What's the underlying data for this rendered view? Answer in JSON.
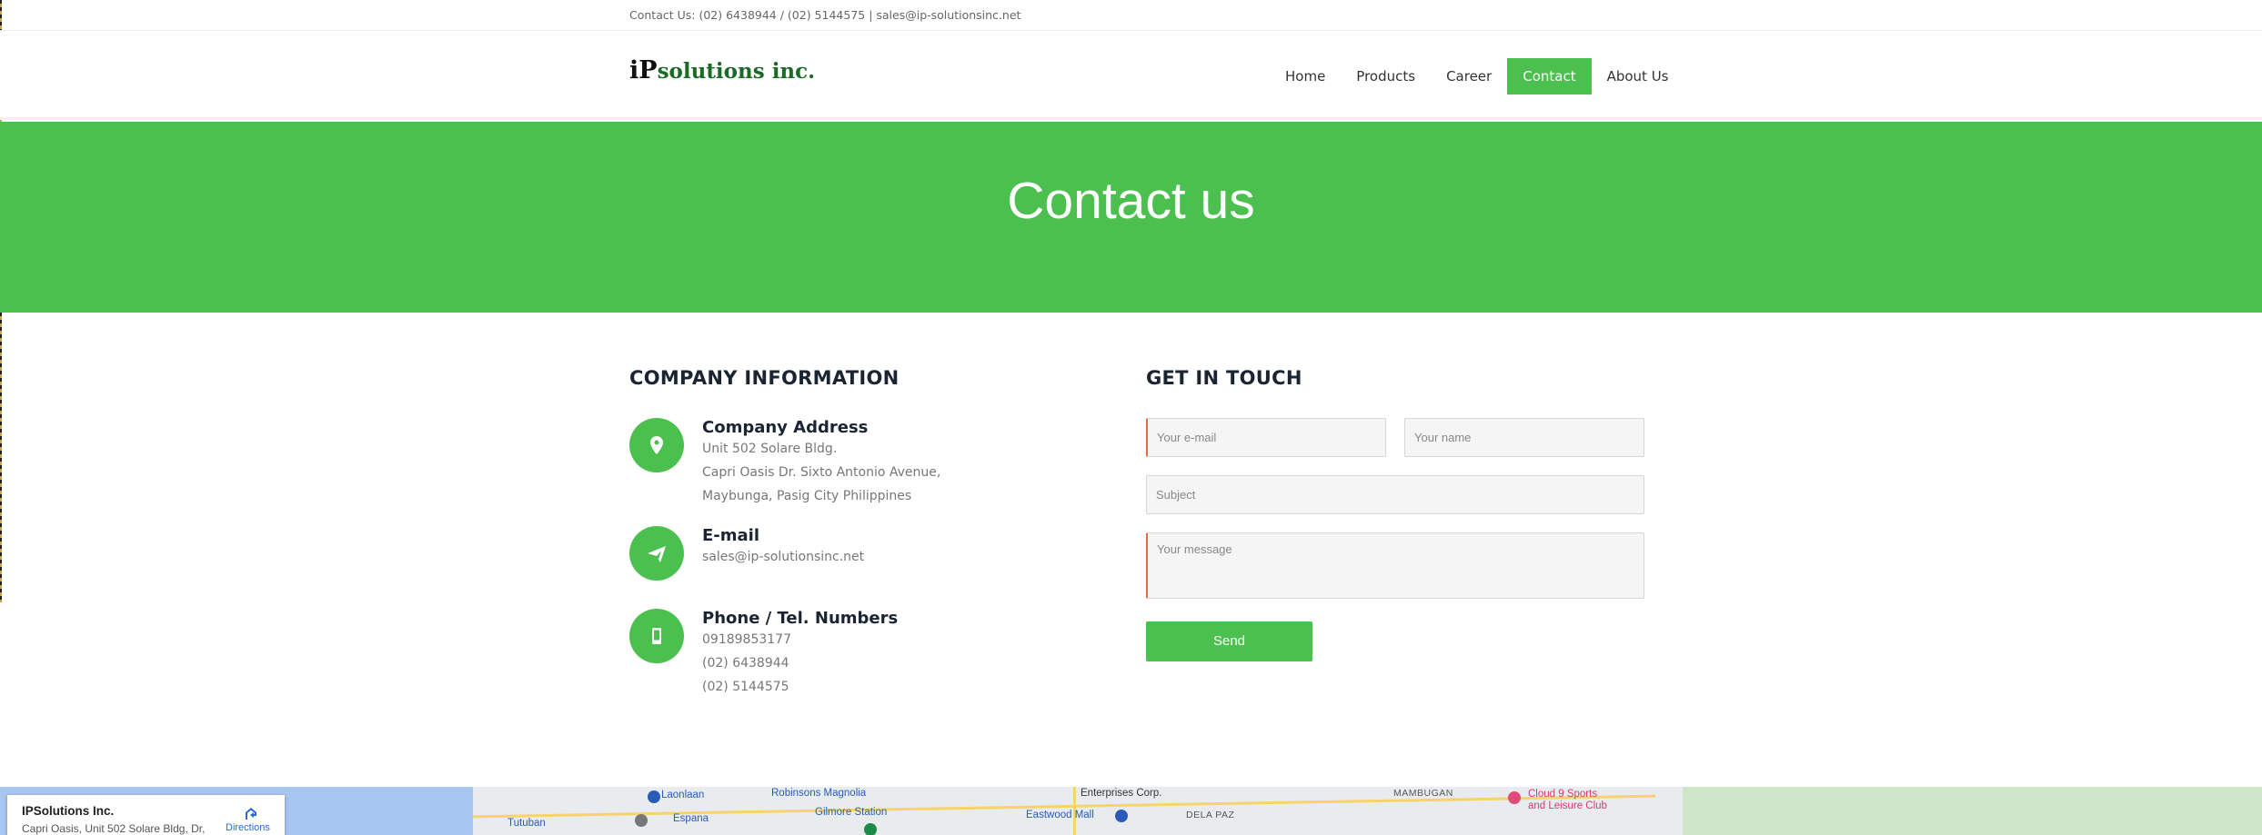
{
  "topbar": {
    "contact_text": "Contact Us: (02) 6438944 / (02) 5144575 | sales@ip-solutionsinc.net"
  },
  "header": {
    "logo_prefix": "iP",
    "logo_suffix": "solutions inc.",
    "nav": [
      {
        "label": "Home",
        "active": false
      },
      {
        "label": "Products",
        "active": false
      },
      {
        "label": "Career",
        "active": false
      },
      {
        "label": "Contact",
        "active": true
      },
      {
        "label": "About Us",
        "active": false
      }
    ]
  },
  "hero": {
    "title": "Contact us"
  },
  "company_info": {
    "title": "COMPANY INFORMATION",
    "address": {
      "icon": "location-pin-icon",
      "heading": "Company Address",
      "lines": [
        "Unit 502 Solare Bldg.",
        "Capri Oasis Dr. Sixto Antonio Avenue,",
        "Maybunga, Pasig City Philippines"
      ]
    },
    "email": {
      "icon": "paper-plane-icon",
      "heading": "E-mail",
      "lines": [
        "sales@ip-solutionsinc.net"
      ]
    },
    "phone": {
      "icon": "phone-icon",
      "heading": "Phone / Tel. Numbers",
      "lines": [
        "09189853177",
        "(02) 6438944",
        "(02) 5144575"
      ]
    }
  },
  "contact_form": {
    "title": "GET IN TOUCH",
    "email_placeholder": "Your e-mail",
    "name_placeholder": "Your name",
    "subject_placeholder": "Subject",
    "message_placeholder": "Your message",
    "send_label": "Send"
  },
  "map": {
    "card_title": "IPSolutions Inc.",
    "card_address": "Capri Oasis, Unit 502 Solare Bldg, Dr,",
    "directions_label": "Directions",
    "labels": [
      {
        "text": "Laonlaan",
        "style": "blue"
      },
      {
        "text": "Robinsons Magnolia",
        "style": "blue"
      },
      {
        "text": "Enterprises Corp.",
        "style": ""
      },
      {
        "text": "MAMBUGAN",
        "style": "gray"
      },
      {
        "text": "Cloud 9 Sports",
        "style": "pink"
      },
      {
        "text": "and Leisure Club",
        "style": "pink"
      },
      {
        "text": "Tutuban",
        "style": "blue"
      },
      {
        "text": "Espana",
        "style": "blue"
      },
      {
        "text": "Gilmore Station",
        "style": "blue"
      },
      {
        "text": "Eastwood Mall",
        "style": "blue"
      },
      {
        "text": "DELA PAZ",
        "style": "gray"
      }
    ]
  },
  "colors": {
    "accent_green": "#4bc04f",
    "heading_dark": "#1a2433",
    "logo_green": "#1b6b26"
  }
}
